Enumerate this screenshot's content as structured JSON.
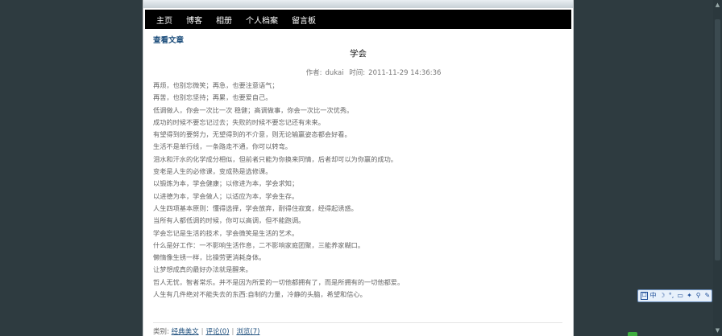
{
  "nav": {
    "items": [
      "主页",
      "博客",
      "相册",
      "个人档案",
      "留言板"
    ]
  },
  "section_title": "查看文章",
  "article": {
    "title": "学会",
    "author_label": "作者:",
    "author": "dukai",
    "time_label": "时间:",
    "time": "2011-11-29 14:36:36",
    "lines": [
      "再烦，也别忘微笑；再急，也要注意语气；",
      "再苦，也别忘坚持；再累，也要爱自己。",
      "低调做人，你会一次比一次 稳健；高调做事，你会一次比一次优秀。",
      "成功的时候不要忘记过去；失败的时候不要忘记还有未来。",
      "有望得到的要努力，无望得到的不介意，则无论输赢姿态都会好看。",
      "生活不是单行线，一条路走不通，你可以转弯。",
      "泪水和汗水的化学成分相似，但前者只能为你换来同情，后者却可以为你赢的成功。",
      "变老是人生的必修课，变成熟是选修课。",
      "以锻炼为本，学会健康；以修进为本，学会求知；",
      "以进德为本，学会做人；以适应为本，学会生存。",
      "人生四项基本原则：懂得选择，学会放弃，耐得住寂寞，经得起诱惑。",
      "当所有人都低调的时候，你可以高调，但不能跑调。",
      "学会忘记是生活的技术，学会微笑是生活的艺术。",
      "什么是好工作：一不影响生活作息，二不影响家庭团聚，三能养家糊口。",
      "懒惰像生锈一样，比操劳更消耗身体。",
      "让梦想成真的最好办法就是醒来。",
      "哲人无忧，智者常乐。并不是因为所爱的一切他都拥有了，而是所拥有的一切他都爱。",
      "人生有几件绝对不能失去的东西:自制的力量，冷静的头脑，希望和信心。"
    ]
  },
  "footer": {
    "category_label": "类别:",
    "category": "经典美文",
    "comments": "评论(0)",
    "views": "浏览(7)"
  },
  "ime": {
    "lead": "囗",
    "items": [
      "中",
      "☽",
      "°,",
      "▭",
      "✦",
      "⚲",
      "✎"
    ]
  },
  "colors": {
    "background": "#2e3b40",
    "nav_bar": "#000000",
    "section_title": "#1d4e7c",
    "body_text": "#666666"
  }
}
